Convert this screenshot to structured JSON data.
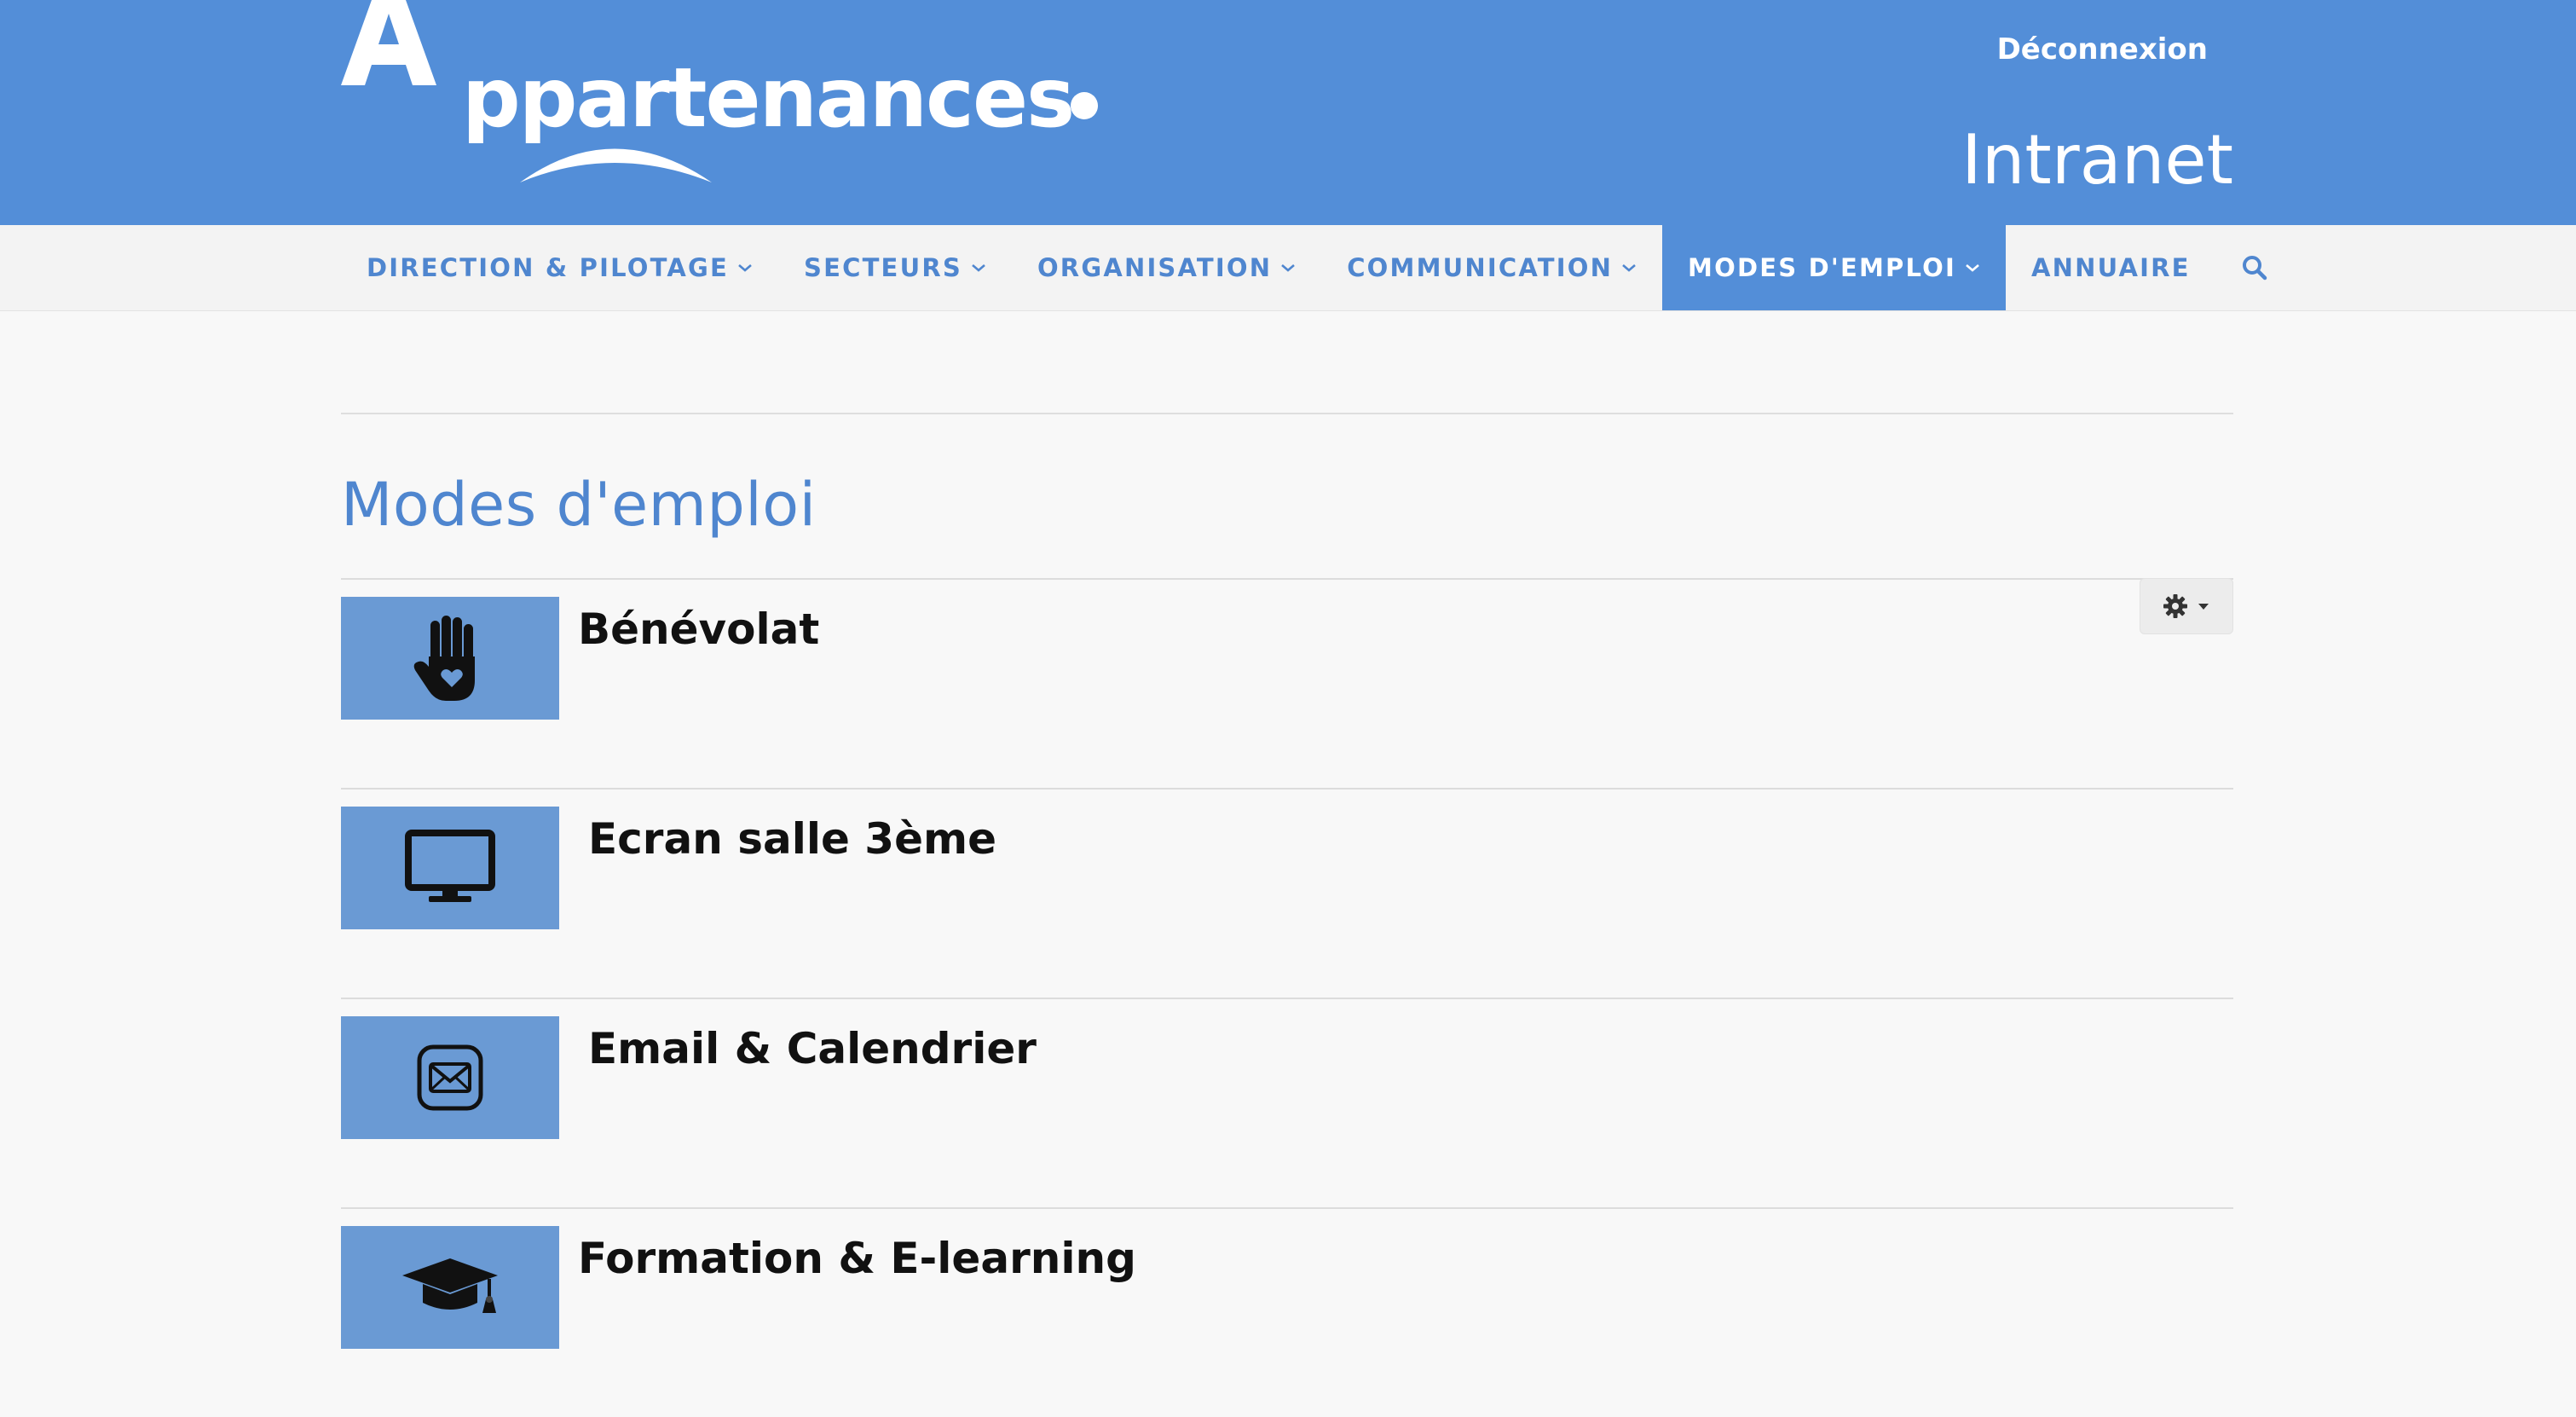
{
  "header": {
    "brand": "Appartenances",
    "logout_label": "Déconnexion",
    "section_label": "Intranet"
  },
  "nav": {
    "items": [
      {
        "label": "Direction & pilotage",
        "dropdown": true,
        "active": false
      },
      {
        "label": "Secteurs",
        "dropdown": true,
        "active": false
      },
      {
        "label": "Organisation",
        "dropdown": true,
        "active": false
      },
      {
        "label": "Communication",
        "dropdown": true,
        "active": false
      },
      {
        "label": "Modes d'emploi",
        "dropdown": true,
        "active": true
      },
      {
        "label": "Annuaire",
        "dropdown": false,
        "active": false
      }
    ],
    "search_icon": "search-icon"
  },
  "page": {
    "title": "Modes d'emploi",
    "settings_icon": "gear-icon"
  },
  "list": [
    {
      "title": "Bénévolat",
      "icon": "hand-heart-icon"
    },
    {
      "title": "Ecran salle 3ème",
      "icon": "monitor-icon"
    },
    {
      "title": "Email & Calendrier",
      "icon": "envelope-icon"
    },
    {
      "title": "Formation & E-learning",
      "icon": "graduation-cap-icon"
    }
  ],
  "colors": {
    "brand_blue": "#538ed8",
    "link_blue": "#4f86cf",
    "thumb_blue": "#6a9ad4",
    "background": "#f8f8f8"
  }
}
